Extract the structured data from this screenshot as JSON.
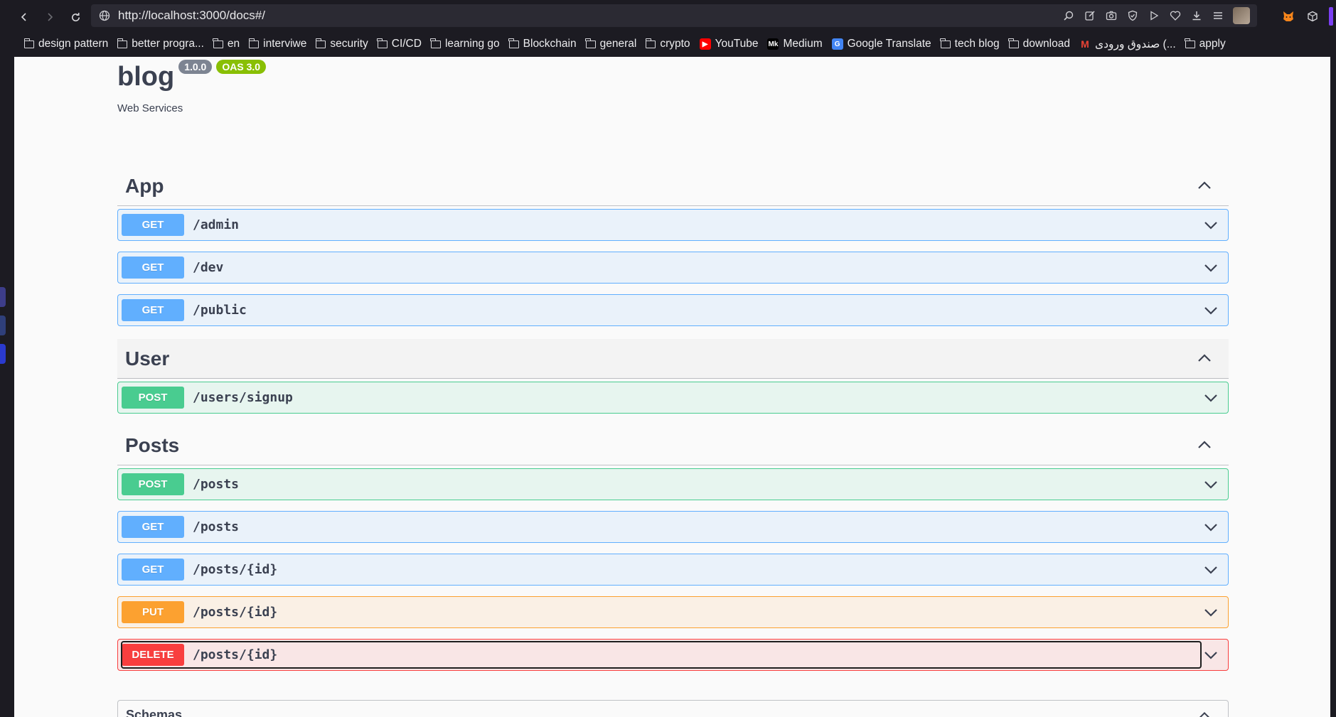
{
  "browser": {
    "url": "http://localhost:3000/docs#/",
    "bookmarks": [
      {
        "label": "design pattern",
        "icon": "folder"
      },
      {
        "label": "better progra...",
        "icon": "folder"
      },
      {
        "label": "en",
        "icon": "folder"
      },
      {
        "label": "interviwe",
        "icon": "folder"
      },
      {
        "label": "security",
        "icon": "folder"
      },
      {
        "label": "CI/CD",
        "icon": "folder"
      },
      {
        "label": "learning go",
        "icon": "folder"
      },
      {
        "label": "Blockchain",
        "icon": "folder"
      },
      {
        "label": "general",
        "icon": "folder"
      },
      {
        "label": "crypto",
        "icon": "folder"
      },
      {
        "label": "YouTube",
        "icon": "youtube"
      },
      {
        "label": "Medium",
        "icon": "medium"
      },
      {
        "label": "Google Translate",
        "icon": "google-translate"
      },
      {
        "label": "tech blog",
        "icon": "folder"
      },
      {
        "label": "download",
        "icon": "folder"
      },
      {
        "label": "صندوق ورودی (...",
        "icon": "gmail"
      },
      {
        "label": "apply",
        "icon": "folder"
      }
    ],
    "favicon_glyphs": {
      "youtube": "▶",
      "medium": "Mk",
      "google-translate": "G",
      "gmail": "M"
    }
  },
  "info": {
    "title": "blog",
    "version": "1.0.0",
    "oas": "OAS 3.0",
    "description": "Web Services"
  },
  "sections": [
    {
      "name": "App",
      "operations": [
        {
          "method": "GET",
          "path": "/admin"
        },
        {
          "method": "GET",
          "path": "/dev"
        },
        {
          "method": "GET",
          "path": "/public"
        }
      ]
    },
    {
      "name": "User",
      "operations": [
        {
          "method": "POST",
          "path": "/users/signup"
        }
      ]
    },
    {
      "name": "Posts",
      "operations": [
        {
          "method": "POST",
          "path": "/posts"
        },
        {
          "method": "GET",
          "path": "/posts"
        },
        {
          "method": "GET",
          "path": "/posts/{id}"
        },
        {
          "method": "PUT",
          "path": "/posts/{id}"
        },
        {
          "method": "DELETE",
          "path": "/posts/{id}"
        }
      ]
    }
  ],
  "schemas": {
    "title": "Schemas"
  },
  "colors": {
    "get": "#61affe",
    "post": "#49cc90",
    "put": "#fca130",
    "delete": "#f93e3e",
    "text": "#3b4151"
  }
}
